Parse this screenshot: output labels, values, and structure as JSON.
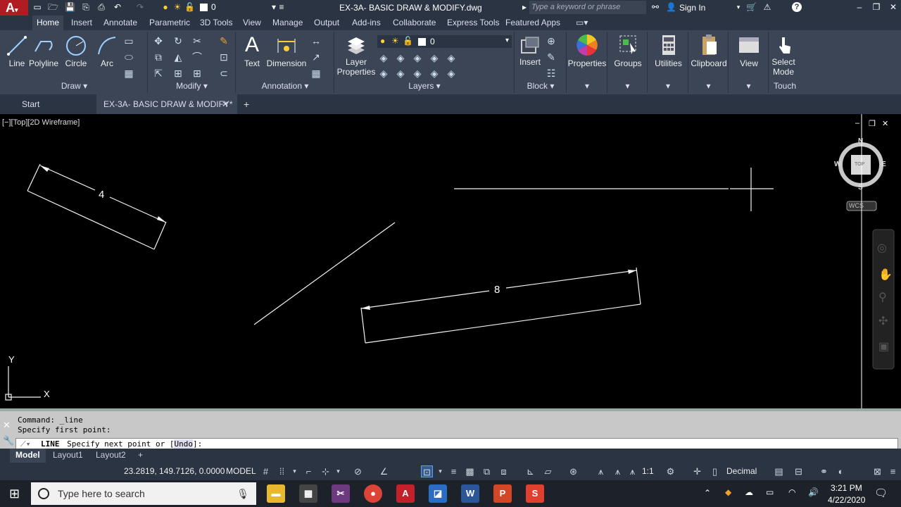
{
  "app": {
    "window_title": "EX-3A- BASIC DRAW & MODIFY.dwg",
    "search_placeholder": "Type a keyword or phrase",
    "sign_in": "Sign In",
    "layer_current": "0"
  },
  "ribbon_tabs": [
    "Home",
    "Insert",
    "Annotate",
    "Parametric",
    "3D Tools",
    "View",
    "Manage",
    "Output",
    "Add-ins",
    "Collaborate",
    "Express Tools",
    "Featured Apps"
  ],
  "ribbon": {
    "draw": {
      "title": "Draw",
      "line": "Line",
      "polyline": "Polyline",
      "circle": "Circle",
      "arc": "Arc"
    },
    "modify": {
      "title": "Modify"
    },
    "annotation": {
      "title": "Annotation",
      "text": "Text",
      "dimension": "Dimension"
    },
    "layers": {
      "title": "Layers",
      "layer_properties_1": "Layer",
      "layer_properties_2": "Properties",
      "layer_value": "0"
    },
    "block": {
      "title": "Block",
      "insert": "Insert"
    },
    "properties": {
      "label": "Properties"
    },
    "groups": {
      "label": "Groups"
    },
    "utilities": {
      "label": "Utilities"
    },
    "clipboard": {
      "label": "Clipboard"
    },
    "view": {
      "label": "View"
    },
    "touch": {
      "title": "Touch",
      "select_1": "Select",
      "select_2": "Mode"
    }
  },
  "doc_tabs": {
    "start": "Start",
    "current": "EX-3A- BASIC DRAW & MODIFY*"
  },
  "viewport": {
    "label": "[−][Top][2D Wireframe]",
    "viewcube": {
      "n": "N",
      "s": "S",
      "e": "E",
      "w": "W",
      "top": "TOP",
      "wcs": "WCS"
    },
    "ucs": {
      "x": "X",
      "y": "Y"
    },
    "dim_small": "4",
    "dim_large": "8"
  },
  "command": {
    "history_1": "Command: _line",
    "history_2": "Specify first point:",
    "prompt_cmd": "LINE",
    "prompt_text": "Specify next point or [",
    "prompt_option": "Undo",
    "prompt_end": "]:"
  },
  "layout_tabs": [
    "Model",
    "Layout1",
    "Layout2"
  ],
  "status": {
    "coords": "23.2819, 149.7126, 0.0000",
    "model": "MODEL",
    "scale": "1:1",
    "units": "Decimal"
  },
  "taskbar": {
    "search_placeholder": "Type here to search",
    "time": "3:21 PM",
    "date": "4/22/2020"
  }
}
